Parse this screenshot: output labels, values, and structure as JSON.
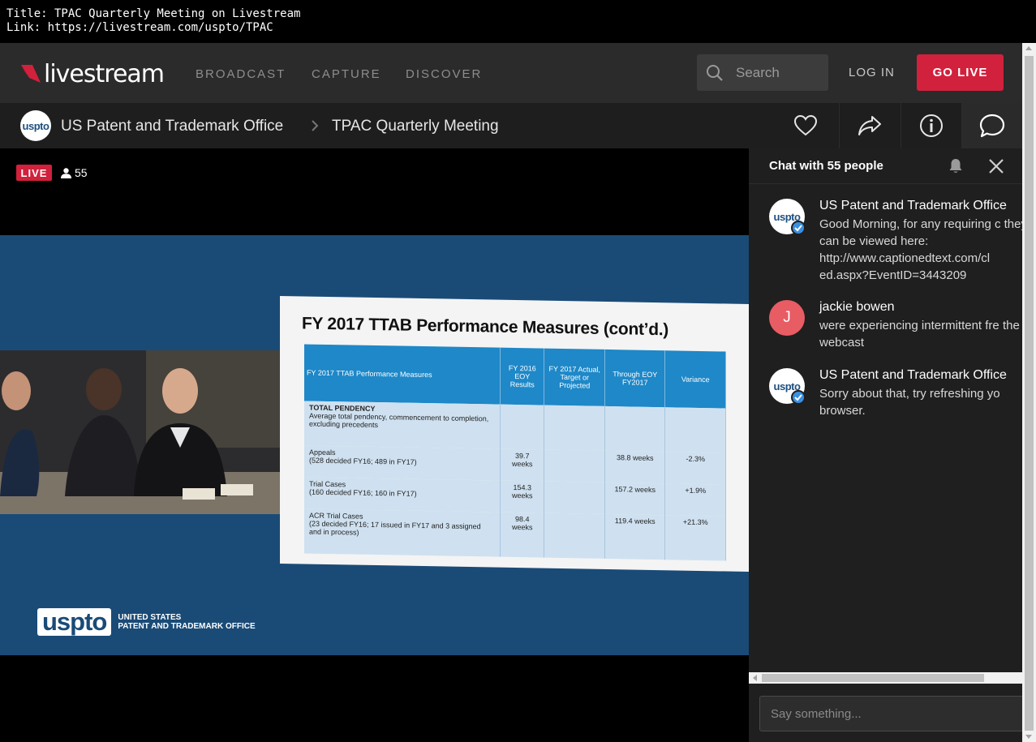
{
  "info": {
    "title_line": "Title: TPAC Quarterly Meeting on Livestream",
    "link_line": "Link: https://livestream.com/uspto/TPAC"
  },
  "header": {
    "logo_text": "livestream",
    "nav": [
      "BROADCAST",
      "CAPTURE",
      "DISCOVER"
    ],
    "search_placeholder": "Search",
    "login_label": "LOG IN",
    "golive_label": "GO LIVE",
    "brand_color": "#d1213c"
  },
  "subheader": {
    "channel_avatar_text": "uspto",
    "channel_name": "US Patent and Trademark Office",
    "event_title": "TPAC Quarterly Meeting",
    "icons": [
      "heart-icon",
      "share-icon",
      "info-icon",
      "chat-icon"
    ]
  },
  "video": {
    "live_label": "LIVE",
    "viewer_count": "55",
    "slide": {
      "title": "FY 2017 TTAB Performance Measures (cont’d.)",
      "headers": [
        "FY 2017 TTAB Performance Measures",
        "FY 2016 EOY Results",
        "FY 2017 Actual, Target or Projected",
        "Through EOY FY2017",
        "Variance"
      ],
      "rows": [
        {
          "label": "TOTAL PENDENCY",
          "sub": "Average total pendency, commencement to completion, excluding precedents",
          "c1": "",
          "c2": "",
          "c3": "",
          "c4": ""
        },
        {
          "label": "Appeals",
          "sub": "(528 decided FY16; 489 in FY17)",
          "c1": "39.7 weeks",
          "c2": "",
          "c3": "38.8 weeks",
          "c4": "-2.3%"
        },
        {
          "label": "Trial Cases",
          "sub": "(160 decided FY16; 160 in FY17)",
          "c1": "154.3 weeks",
          "c2": "",
          "c3": "157.2 weeks",
          "c4": "+1.9%"
        },
        {
          "label": "ACR Trial Cases",
          "sub": "(23 decided FY16; 17 issued in FY17 and 3 assigned and in process)",
          "c1": "98.4 weeks",
          "c2": "",
          "c3": "119.4 weeks",
          "c4": "+21.3%"
        }
      ]
    },
    "footer_logo": "uspto",
    "footer_line1": "UNITED STATES",
    "footer_line2": "PATENT AND TRADEMARK OFFICE"
  },
  "chat": {
    "title": "Chat with 55 people",
    "messages": [
      {
        "author": "US Patent and Trademark Office",
        "avatar": "uspto",
        "text": "Good Morning, for any requiring c they can be viewed here: http://www.captionedtext.com/cl ed.aspx?EventID=3443209"
      },
      {
        "author": "jackie bowen",
        "avatar": "J",
        "text": "were experiencing intermittent fre the webcast"
      },
      {
        "author": "US Patent and Trademark Office",
        "avatar": "uspto",
        "text": "Sorry about that, try refreshing yo browser."
      }
    ],
    "input_placeholder": "Say something..."
  }
}
